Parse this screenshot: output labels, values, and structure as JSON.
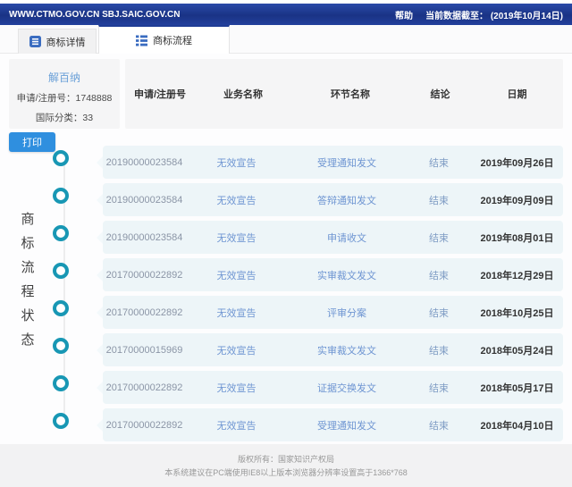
{
  "topbar": {
    "site": "WWW.CTMO.GOV.CN SBJ.SAIC.GOV.CN",
    "help_label": "帮助",
    "data_cutoff": "当前数据截至： (2019年10月14日)"
  },
  "tabs": [
    {
      "label": "商标详情",
      "active": false
    },
    {
      "label": "商标流程",
      "active": true
    }
  ],
  "trademark": {
    "name": "解百纳",
    "reg_no": "申请/注册号：1748888",
    "intl_class": "国际分类：33"
  },
  "print_label": "打印",
  "panel": {
    "vertical_title": "商标流程状态"
  },
  "table": {
    "headers": [
      "申请/注册号",
      "业务名称",
      "环节名称",
      "结论",
      "日期"
    ],
    "rows": [
      {
        "reg_no": "20190000023584",
        "business": "无效宣告",
        "step": "受理通知发文",
        "conclusion": "结束",
        "date": "2019年09月26日"
      },
      {
        "reg_no": "20190000023584",
        "business": "无效宣告",
        "step": "答辩通知发文",
        "conclusion": "结束",
        "date": "2019年09月09日"
      },
      {
        "reg_no": "20190000023584",
        "business": "无效宣告",
        "step": "申请收文",
        "conclusion": "结束",
        "date": "2019年08月01日"
      },
      {
        "reg_no": "20170000022892",
        "business": "无效宣告",
        "step": "实审裁文发文",
        "conclusion": "结束",
        "date": "2018年12月29日"
      },
      {
        "reg_no": "20170000022892",
        "business": "无效宣告",
        "step": "评审分案",
        "conclusion": "结束",
        "date": "2018年10月25日"
      },
      {
        "reg_no": "20170000015969",
        "business": "无效宣告",
        "step": "实审裁文发文",
        "conclusion": "结束",
        "date": "2018年05月24日"
      },
      {
        "reg_no": "20170000022892",
        "business": "无效宣告",
        "step": "证据交换发文",
        "conclusion": "结束",
        "date": "2018年05月17日"
      },
      {
        "reg_no": "20170000022892",
        "business": "无效宣告",
        "step": "受理通知发文",
        "conclusion": "结束",
        "date": "2018年04月10日"
      }
    ]
  },
  "footer": {
    "line1": "版权所有：国家知识产权局",
    "line2": "本系统建议在PC端使用IE8以上版本浏览器分辨率设置高于1366*768"
  },
  "colors": {
    "topbar_navy": "#1f3c95",
    "timeline_teal": "#1897b4",
    "print_blue": "#2f8fdf",
    "row_bg": "#edf5f8",
    "link_blue": "#6e95d2",
    "trademark_name_blue": "#6aa0d8"
  }
}
